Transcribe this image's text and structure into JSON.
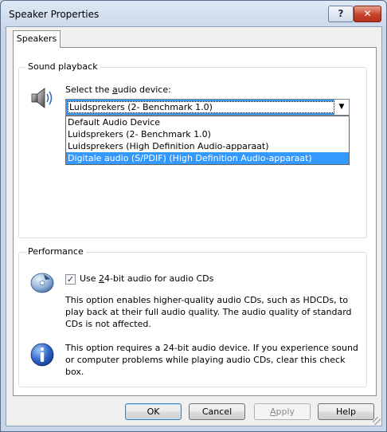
{
  "window": {
    "title": "Speaker Properties",
    "help_button": "?",
    "close_button": "✕"
  },
  "tabs": [
    {
      "label": "Speakers",
      "active": true
    }
  ],
  "sound_playback": {
    "group_label": "Sound playback",
    "device_label_pre": "Select the ",
    "device_label_accel": "a",
    "device_label_post": "udio device:",
    "selected_value": "Luidsprekers (2- Benchmark 1.0)",
    "options": [
      "Default Audio Device",
      "Luidsprekers (2- Benchmark 1.0)",
      "Luidsprekers (High Definition Audio-apparaat)",
      "Digitale audio (S/PDIF) (High Definition Audio-apparaat)"
    ],
    "highlighted_option_index": 3
  },
  "performance": {
    "group_label": "Performance",
    "checkbox_checked": true,
    "checkbox_label_pre": "Use ",
    "checkbox_label_accel": "2",
    "checkbox_label_post": "4-bit audio for audio CDs",
    "description": "This option enables higher-quality audio CDs, such as HDCDs, to play back at their full audio quality. The audio quality of standard CDs is not affected.",
    "note": "This option requires a 24-bit audio device. If you experience sound or computer problems while playing audio CDs, clear this check box."
  },
  "buttons": {
    "ok": "OK",
    "cancel": "Cancel",
    "apply_pre": "",
    "apply_accel": "A",
    "apply_post": "pply",
    "help": "Help"
  },
  "icons": {
    "speaker": "speaker-icon",
    "cd": "cd-icon",
    "info": "info-icon",
    "check": "✓",
    "dropdown_arrow": "▼"
  },
  "colors": {
    "selection": "#3399ff",
    "close_button": "#c8432b"
  }
}
